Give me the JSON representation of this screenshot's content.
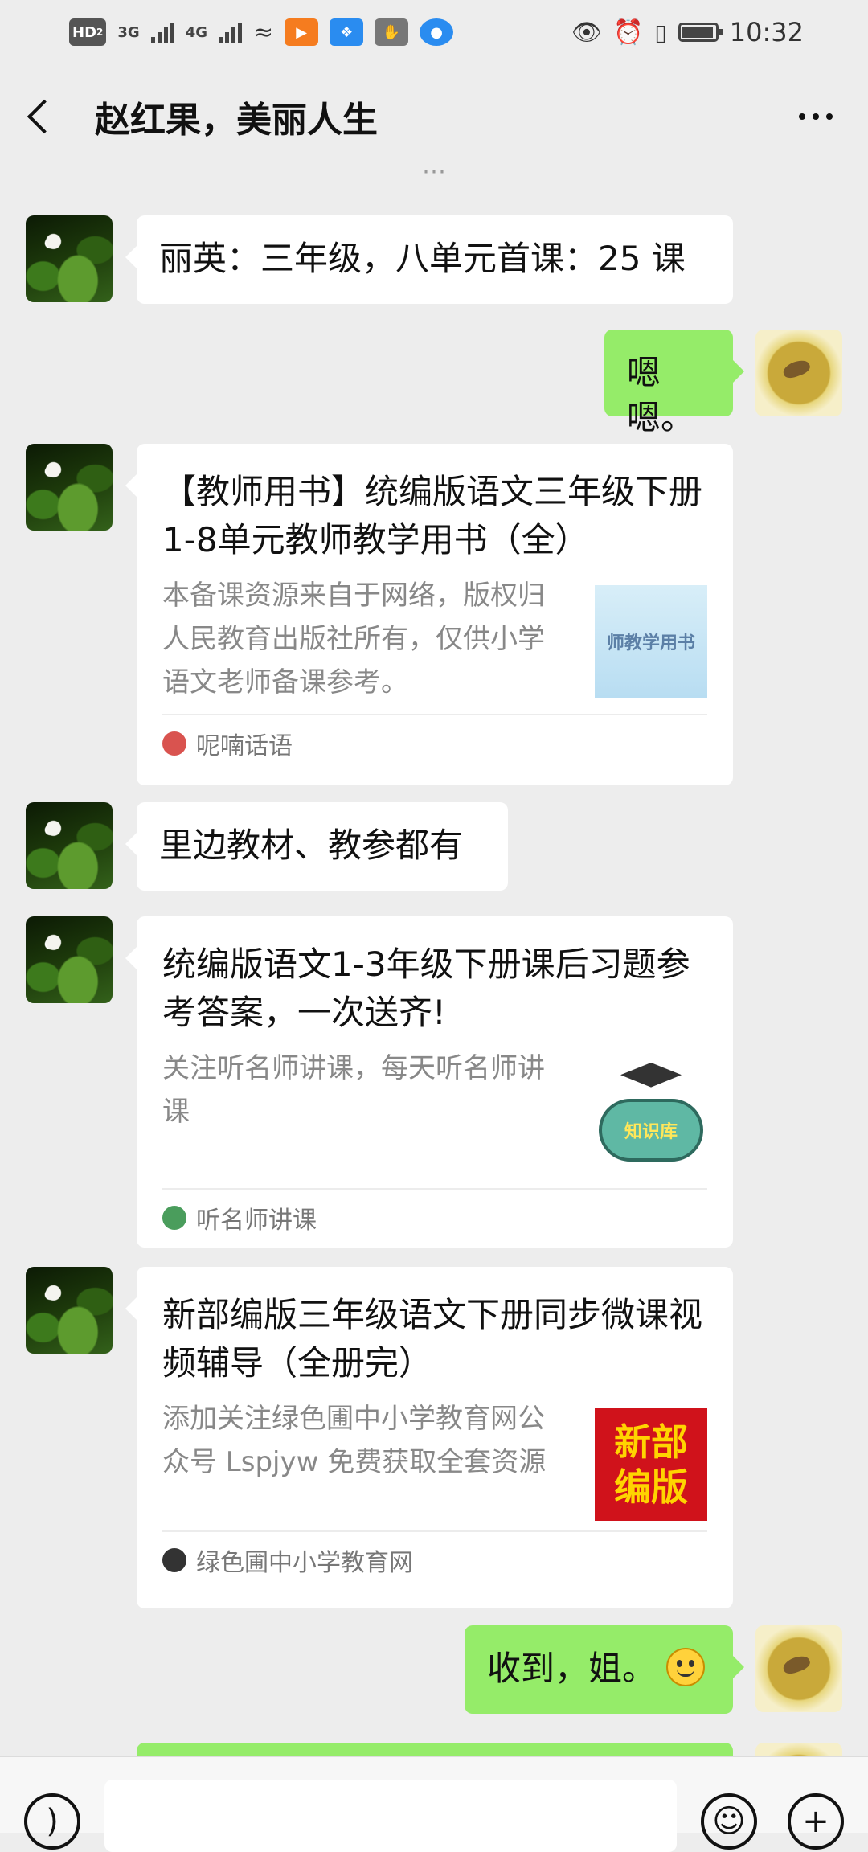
{
  "status_bar": {
    "hd_label": "HD",
    "hd_sub": "2",
    "net1": "3G",
    "net2": "4G",
    "time": "10:32"
  },
  "header": {
    "title": "赵红果，美丽人生"
  },
  "messages": {
    "m1": "丽英：三年级，八单元首课：25 课",
    "m2": "嗯嗯。",
    "m3": "里边教材、教参都有",
    "m4": "收到，姐。"
  },
  "cards": [
    {
      "title": "【教师用书】统编版语文三年级下册1-8单元教师教学用书（全）",
      "desc": "本备课资源来自于网络，版权归人民教育出版社所有，仅供小学语文老师备课参考。",
      "thumb_text": "师教学用书",
      "source": "呢喃话语"
    },
    {
      "title": "统编版语文1-3年级下册课后习题参考答案，一次送齐!",
      "desc": "关注听名师讲课，每天听名师讲课",
      "thumb_text": "知识库",
      "source": "听名师讲课"
    },
    {
      "title": "新部编版三年级语文下册同步微课视频辅导（全册完）",
      "desc": "添加关注绿色圃中小学教育网公众号 Lspjyw 免费获取全套资源",
      "thumb_line1": "新部",
      "thumb_line2": "编版",
      "source": "绿色圃中小学教育网"
    }
  ],
  "input_bar": {
    "voice_icon": "voice-icon",
    "emoji_icon": "emoji-icon",
    "plus_icon": "plus-icon"
  },
  "colors": {
    "background": "#ededed",
    "bubble_self": "#95ec69",
    "bubble_other": "#ffffff"
  }
}
